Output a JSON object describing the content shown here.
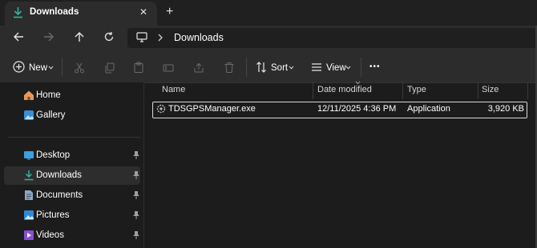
{
  "window": {
    "tab_title": "Downloads",
    "close_glyph": "✕",
    "new_tab_glyph": "+"
  },
  "address": {
    "breadcrumb": "Downloads"
  },
  "toolbar": {
    "new_label": "New",
    "sort_label": "Sort",
    "view_label": "View",
    "more_glyph": "•••"
  },
  "sidebar": {
    "items": [
      {
        "label": "Home"
      },
      {
        "label": "Gallery"
      },
      {
        "label": "Desktop"
      },
      {
        "label": "Downloads"
      },
      {
        "label": "Documents"
      },
      {
        "label": "Pictures"
      },
      {
        "label": "Videos"
      }
    ]
  },
  "columns": {
    "name": "Name",
    "date": "Date modified",
    "type": "Type",
    "size": "Size"
  },
  "files": [
    {
      "name": "TDSGPSManager.exe",
      "date": "12/11/2025 4:36 PM",
      "type": "Application",
      "size": "3,920 KB"
    }
  ],
  "colors": {
    "accent": "#3fb1c4",
    "home": "#e8975a",
    "downloads_icon": "#2fb5a0"
  }
}
